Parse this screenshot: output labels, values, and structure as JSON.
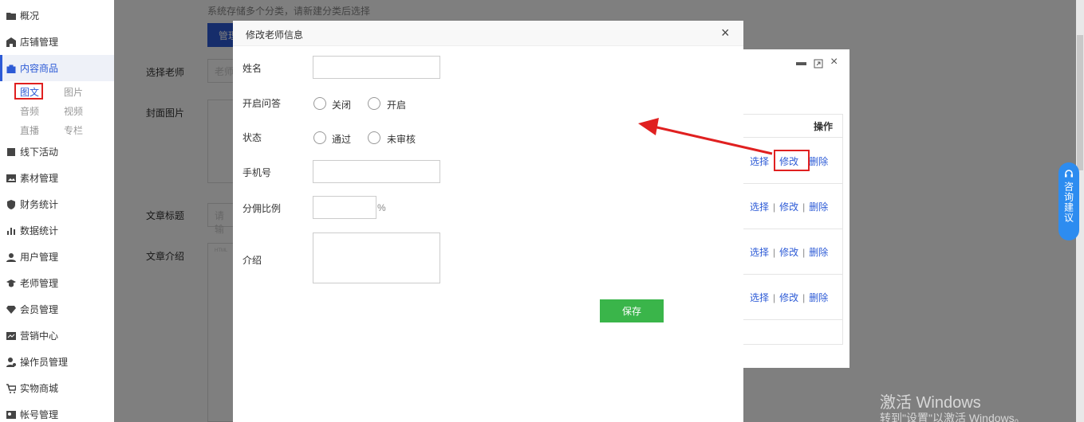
{
  "sidebar": {
    "items": [
      {
        "label": "概况",
        "icon": "folder-icon"
      },
      {
        "label": "店铺管理",
        "icon": "shop-icon"
      },
      {
        "label": "内容商品",
        "icon": "bag-icon"
      },
      {
        "label": "线下活动",
        "icon": "activity-icon"
      },
      {
        "label": "素材管理",
        "icon": "image-icon"
      },
      {
        "label": "财务统计",
        "icon": "shield-icon"
      },
      {
        "label": "数据统计",
        "icon": "bar-chart-icon"
      },
      {
        "label": "用户管理",
        "icon": "user-icon"
      },
      {
        "label": "老师管理",
        "icon": "teacher-icon"
      },
      {
        "label": "会员管理",
        "icon": "diamond-icon"
      },
      {
        "label": "营销中心",
        "icon": "marketing-icon"
      },
      {
        "label": "操作员管理",
        "icon": "operator-icon"
      },
      {
        "label": "实物商城",
        "icon": "cart-icon"
      },
      {
        "label": "帐号管理",
        "icon": "account-icon"
      }
    ],
    "subitems": [
      "图文",
      "图片",
      "音频",
      "视频",
      "直播",
      "专栏"
    ]
  },
  "background": {
    "hint": "系统存储多个分类，请新建分类后选择",
    "manage_btn": "管理",
    "select_teacher": "选择老师",
    "teacher_placeholder": "老师",
    "cover_image": "封面图片",
    "article_title": "文章标题",
    "title_placeholder": "请输",
    "article_intro": "文章介绍",
    "editor_html": "HTML"
  },
  "back_window": {
    "ops_header": "操作",
    "rows": [
      {
        "select": "选择",
        "edit": "修改",
        "delete": "删除"
      },
      {
        "select": "选择",
        "edit": "修改",
        "delete": "删除"
      },
      {
        "select": "选择",
        "edit": "修改",
        "delete": "删除"
      },
      {
        "select": "选择",
        "edit": "修改",
        "delete": "删除"
      }
    ],
    "sep": "|"
  },
  "modal": {
    "title": "修改老师信息",
    "close": "×",
    "name_label": "姓名",
    "qa_label": "开启问答",
    "qa_off": "关闭",
    "qa_on": "开启",
    "status_label": "状态",
    "status_pass": "通过",
    "status_unreviewed": "未审核",
    "phone_label": "手机号",
    "commission_label": "分佣比例",
    "percent": "%",
    "intro_label": "介绍",
    "save": "保存"
  },
  "consult": {
    "label": "咨询建议"
  },
  "watermark": {
    "line1": "激活 Windows",
    "line2": "转到\"设置\"以激活 Windows。"
  },
  "colors": {
    "primary": "#2d5bd6",
    "save": "#3ab54a",
    "highlight": "#e02020",
    "consult": "#2d8cf0"
  }
}
